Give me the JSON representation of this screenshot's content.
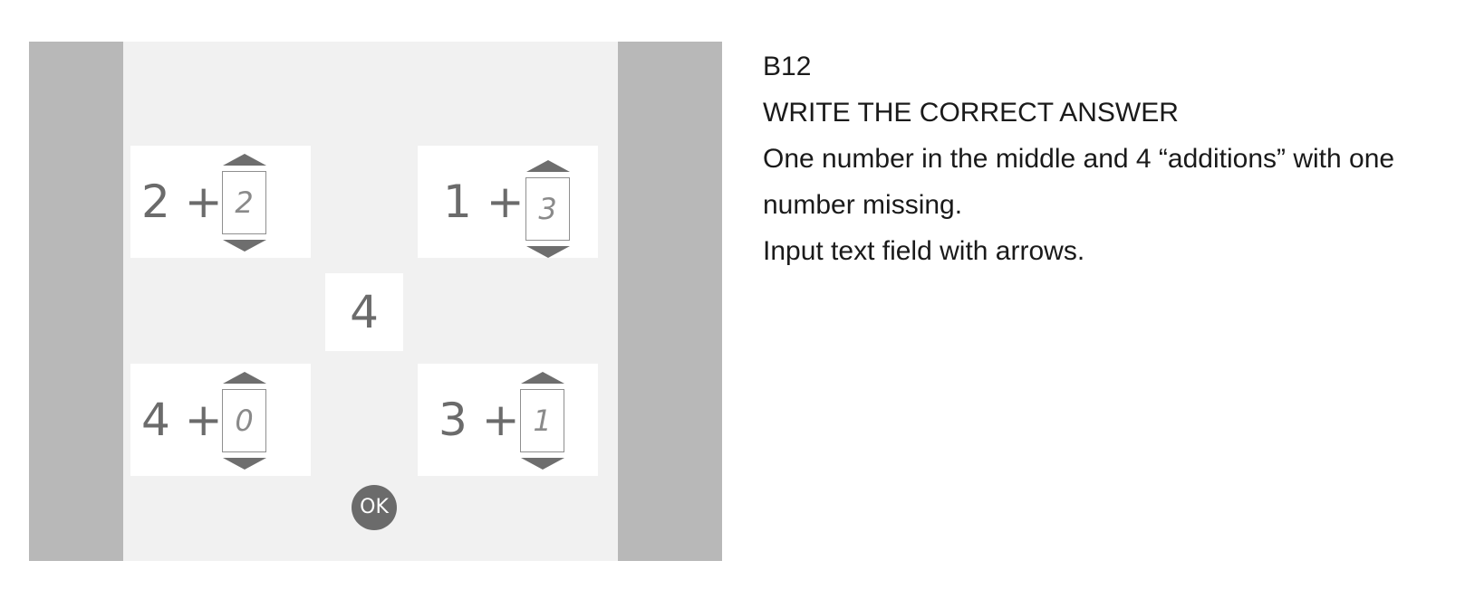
{
  "exercise": {
    "center_number": "4",
    "ok_label": "OK",
    "equations": [
      {
        "operand": "2",
        "operator": "+",
        "answer": "2"
      },
      {
        "operand": "1",
        "operator": "+",
        "answer": "3"
      },
      {
        "operand": "4",
        "operator": "+",
        "answer": "0"
      },
      {
        "operand": "3",
        "operator": "+",
        "answer": "1"
      }
    ]
  },
  "description": {
    "code": "B12",
    "title": "WRITE THE CORRECT ANSWER",
    "line1": "One number in the middle and 4 “additions” with one",
    "line2": "number missing.",
    "line3": "Input text field with arrows."
  },
  "colors": {
    "frame": "#b8b8b8",
    "panel": "#f1f1f1",
    "card": "#ffffff",
    "text": "#6b6b6b",
    "ok_button": "#6b6b6b"
  }
}
